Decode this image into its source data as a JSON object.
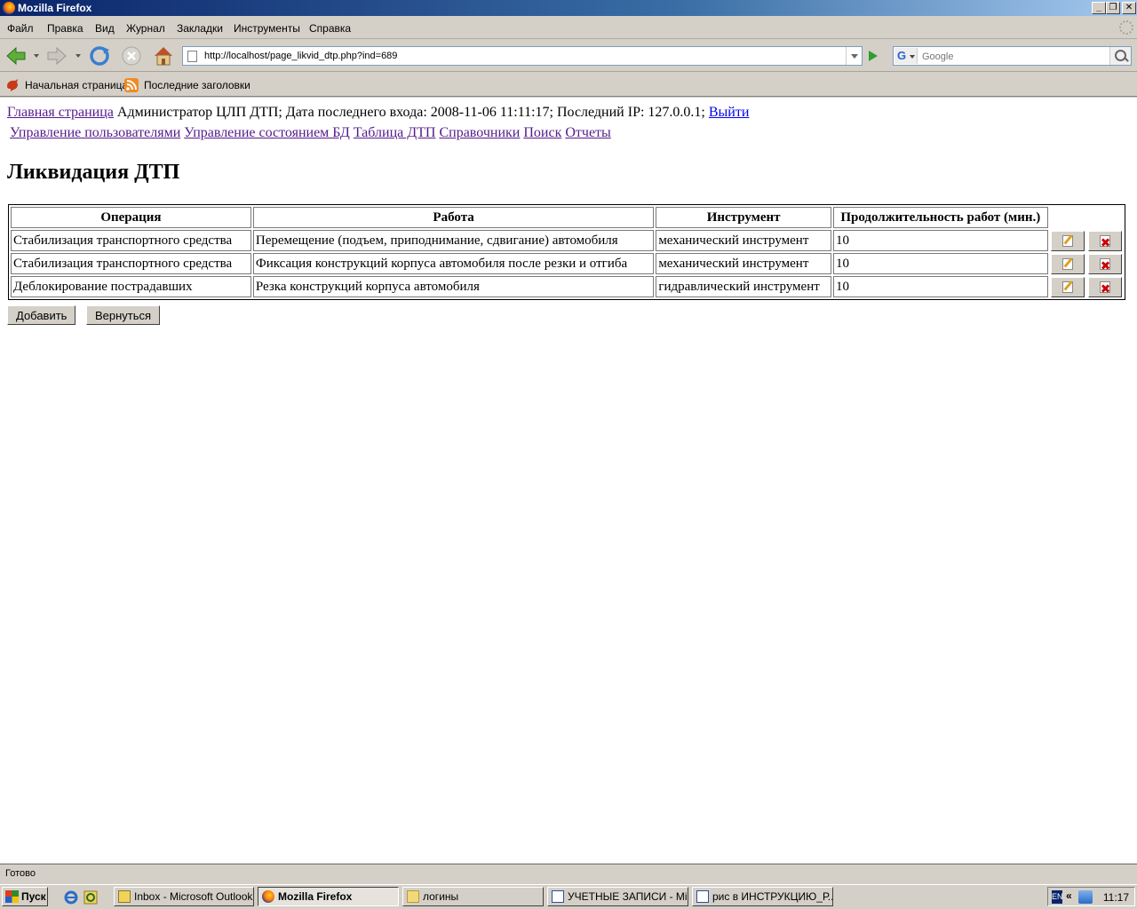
{
  "window": {
    "title": "Mozilla Firefox"
  },
  "menu": [
    "Файл",
    "Правка",
    "Вид",
    "Журнал",
    "Закладки",
    "Инструменты",
    "Справка"
  ],
  "address": {
    "url": "http://localhost/page_likvid_dtp.php?ind=689"
  },
  "search": {
    "engine_letter": "G",
    "placeholder": "Google"
  },
  "bookmarks": [
    "Начальная страница",
    "Последние заголовки"
  ],
  "page": {
    "home_link": "Главная страница",
    "status_text": "Администратор ЦЛП ДТП; Дата последнего входа: 2008-11-06 11:11:17; Последний IP: 127.0.0.1;",
    "logout_link": "Выйти",
    "nav": [
      "Управление пользователями",
      "Управление состоянием БД",
      "Таблица ДТП",
      "Справочники",
      "Поиск",
      "Отчеты"
    ],
    "title": "Ликвидация ДТП",
    "table": {
      "headers": [
        "Операция",
        "Работа",
        "Инструмент",
        "Продолжительность работ (мин.)"
      ],
      "rows": [
        [
          "Стабилизация транспортного средства",
          "Перемещение (подъем, приподнимание, сдвигание) автомобиля",
          "механический инструмент",
          "10"
        ],
        [
          "Стабилизация транспортного средства",
          "Фиксация конструкций корпуса автомобиля после резки и отгиба",
          "механический инструмент",
          "10"
        ],
        [
          "Деблокирование пострадавших",
          "Резка конструкций корпуса автомобиля",
          "гидравлический инструмент",
          "10"
        ]
      ]
    },
    "add_button": "Добавить",
    "back_button": "Вернуться"
  },
  "statusbar": {
    "text": "Готово"
  },
  "taskbar": {
    "start": "Пуск",
    "tasks": [
      "Inbox - Microsoft Outlook",
      "Mozilla Firefox",
      "логины",
      "УЧЕТНЫЕ ЗАПИСИ - Mi...",
      "рис в ИНСТРУКЦИЮ_Р..."
    ],
    "lang": "EN",
    "clock": "11:17"
  },
  "colors": {
    "titlebar": "#0a246a",
    "visited_link": "#551a8b",
    "link": "#0000ee",
    "chrome": "#d4d0c8"
  },
  "icons": [
    "firefox-icon",
    "back-icon",
    "forward-icon",
    "reload-icon",
    "stop-icon",
    "home-icon",
    "go-icon",
    "search-icon",
    "edit-icon",
    "delete-icon"
  ]
}
